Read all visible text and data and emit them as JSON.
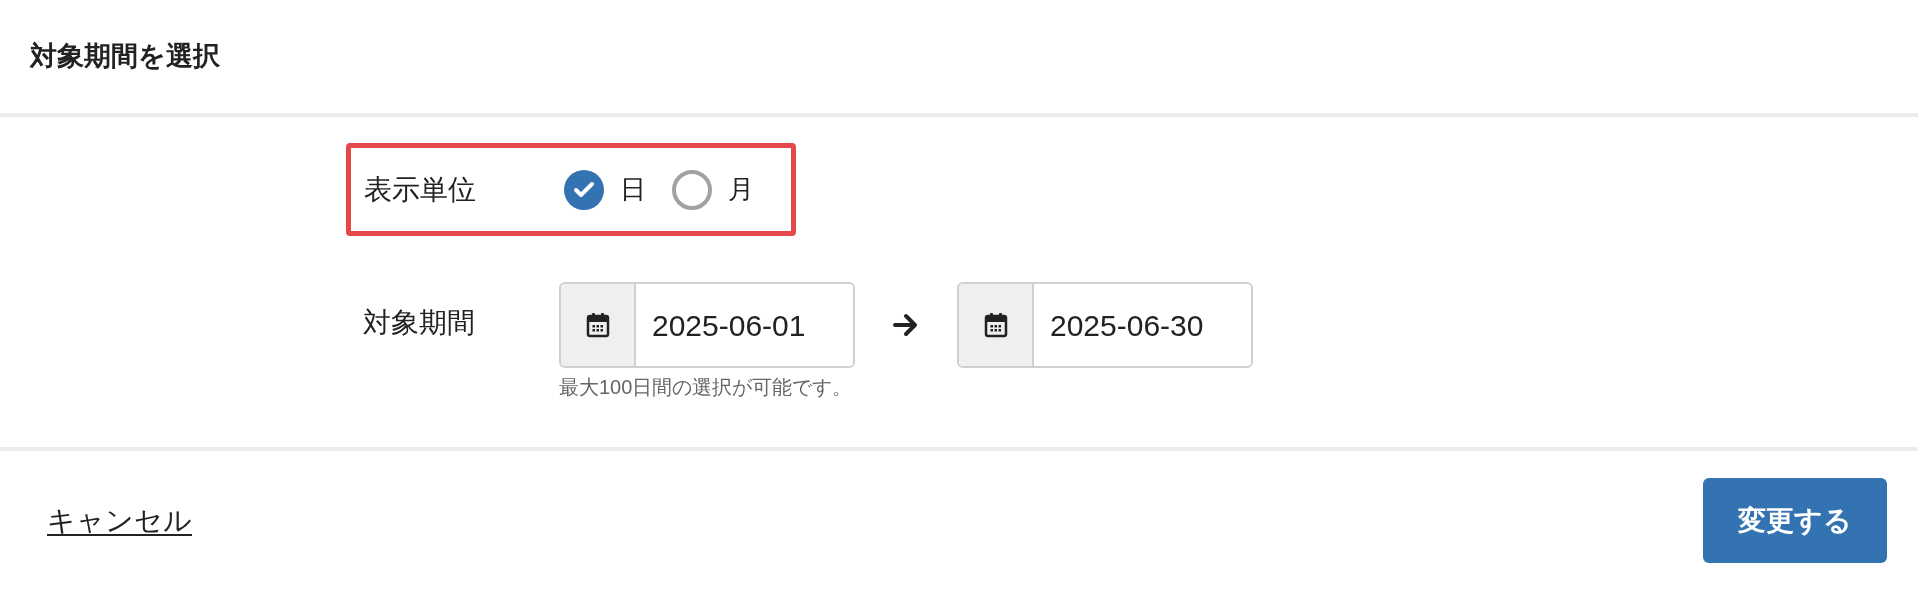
{
  "title": "対象期間を選択",
  "unit": {
    "label": "表示単位",
    "options": [
      {
        "label": "日",
        "selected": true
      },
      {
        "label": "月",
        "selected": false
      }
    ]
  },
  "period": {
    "label": "対象期間",
    "start": "2025-06-01",
    "end": "2025-06-30",
    "help": "最大100日間の選択が可能です。"
  },
  "footer": {
    "cancel": "キャンセル",
    "submit": "変更する"
  }
}
